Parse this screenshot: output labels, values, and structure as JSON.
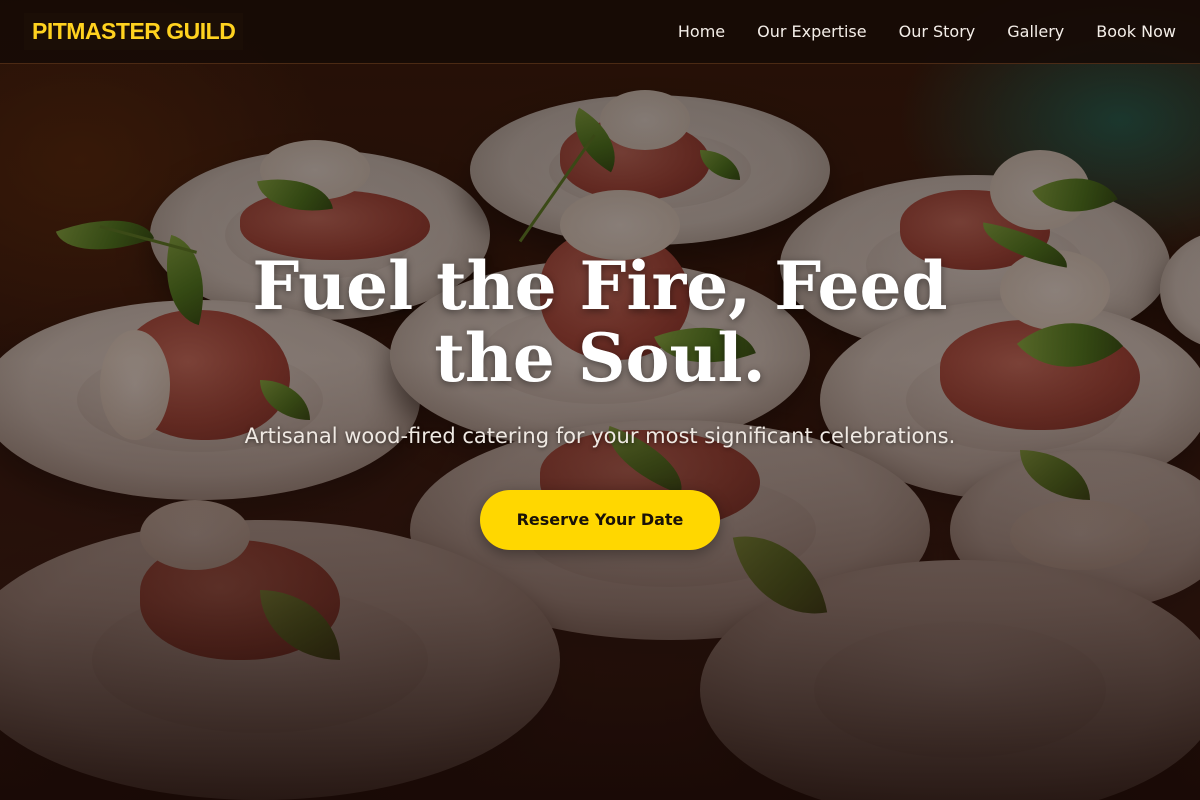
{
  "header": {
    "logo_text": "PITMASTER GUILD",
    "nav": [
      {
        "label": "Home"
      },
      {
        "label": "Our Expertise"
      },
      {
        "label": "Our Story"
      },
      {
        "label": "Gallery"
      },
      {
        "label": "Book Now"
      }
    ]
  },
  "hero": {
    "title": "Fuel the Fire, Feed the Soul.",
    "subtitle": "Artisanal wood-fired catering for your most significant celebrations.",
    "cta_label": "Reserve Your Date",
    "background_image": "catering plates with cured meat and microgreens"
  },
  "colors": {
    "accent": "#ffd700",
    "logo": "#ffd21f",
    "header_bg": "#160a06",
    "text_light": "#ffffff"
  }
}
